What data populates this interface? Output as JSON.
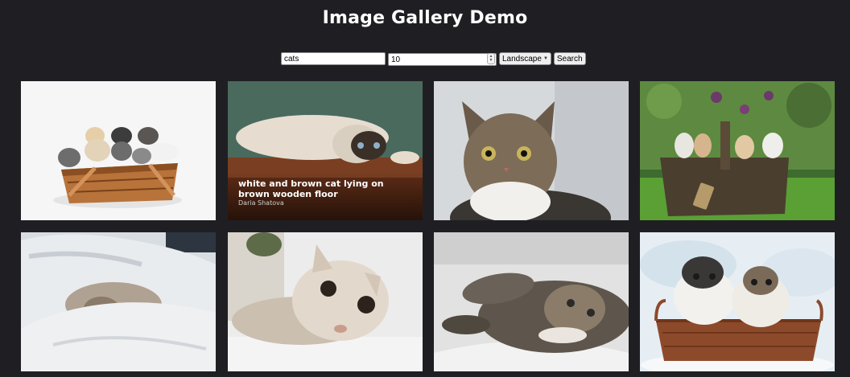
{
  "header": {
    "title": "Image Gallery Demo"
  },
  "search": {
    "query_value": "cats",
    "count_value": "10",
    "orientation_selected": "Landscape",
    "search_label": "Search"
  },
  "gallery": {
    "images": [
      {
        "subject": "kittens in wicker basket"
      },
      {
        "subject": "white and brown cat lying on wooden floor",
        "caption": "white and brown cat lying on brown wooden floor",
        "credit": "Daria Shatova"
      },
      {
        "subject": "tabby cat portrait"
      },
      {
        "subject": "kittens in basket on grass"
      },
      {
        "subject": "cat under white blanket"
      },
      {
        "subject": "scottish fold cat"
      },
      {
        "subject": "tabby cat lying on side"
      },
      {
        "subject": "two kittens in basket"
      }
    ]
  }
}
